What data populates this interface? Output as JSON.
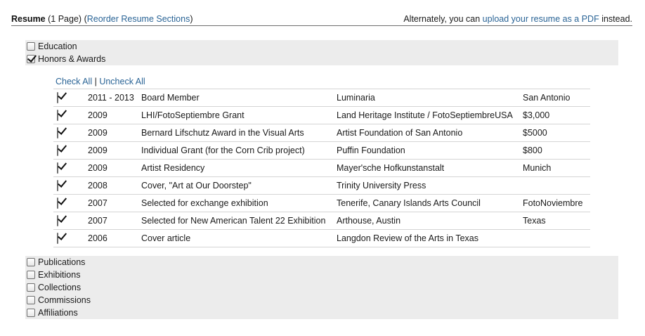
{
  "header": {
    "resume_label": "Resume",
    "page_count": "(1 Page)",
    "open_paren": "(",
    "reorder_link": "Reorder Resume Sections",
    "close_paren": ")",
    "alt_prefix": "Alternately, you can ",
    "upload_link": "upload your resume as a PDF",
    "alt_suffix": " instead."
  },
  "sections_top": [
    {
      "label": "Education",
      "checked": false
    },
    {
      "label": "Honors & Awards",
      "checked": true
    }
  ],
  "honors": {
    "check_all": "Check All",
    "separator": "|",
    "uncheck_all": "Uncheck All",
    "rows": [
      {
        "checked": true,
        "year": "2011 - 2013",
        "title": "Board Member",
        "org": "Luminaria",
        "extra": "San Antonio"
      },
      {
        "checked": true,
        "year": "2009",
        "title": "LHI/FotoSeptiembre Grant",
        "org": "Land Heritage Institute / FotoSeptiembreUSA",
        "extra": "$3,000"
      },
      {
        "checked": true,
        "year": "2009",
        "title": "Bernard Lifschutz Award in the Visual Arts",
        "org": "Artist Foundation of San Antonio",
        "extra": "$5000"
      },
      {
        "checked": true,
        "year": "2009",
        "title": "Individual Grant (for the Corn Crib project)",
        "org": "Puffin Foundation",
        "extra": "$800"
      },
      {
        "checked": true,
        "year": "2009",
        "title": "Artist Residency",
        "org": "Mayer'sche Hofkunstanstalt",
        "extra": "Munich"
      },
      {
        "checked": true,
        "year": "2008",
        "title": "Cover, \"Art at Our Doorstep\"",
        "org": "Trinity University Press",
        "extra": ""
      },
      {
        "checked": true,
        "year": "2007",
        "title": "Selected for exchange exhibition",
        "org": "Tenerife, Canary Islands Arts Council",
        "extra": "FotoNoviembre"
      },
      {
        "checked": true,
        "year": "2007",
        "title": "Selected for New American Talent 22 Exhibition",
        "org": "Arthouse, Austin",
        "extra": "Texas"
      },
      {
        "checked": true,
        "year": "2006",
        "title": "Cover article",
        "org": "Langdon Review of the Arts in Texas",
        "extra": ""
      }
    ]
  },
  "sections_bottom": [
    {
      "label": "Publications",
      "checked": false
    },
    {
      "label": "Exhibitions",
      "checked": false
    },
    {
      "label": "Collections",
      "checked": false
    },
    {
      "label": "Commissions",
      "checked": false
    },
    {
      "label": "Affiliations",
      "checked": false
    }
  ]
}
